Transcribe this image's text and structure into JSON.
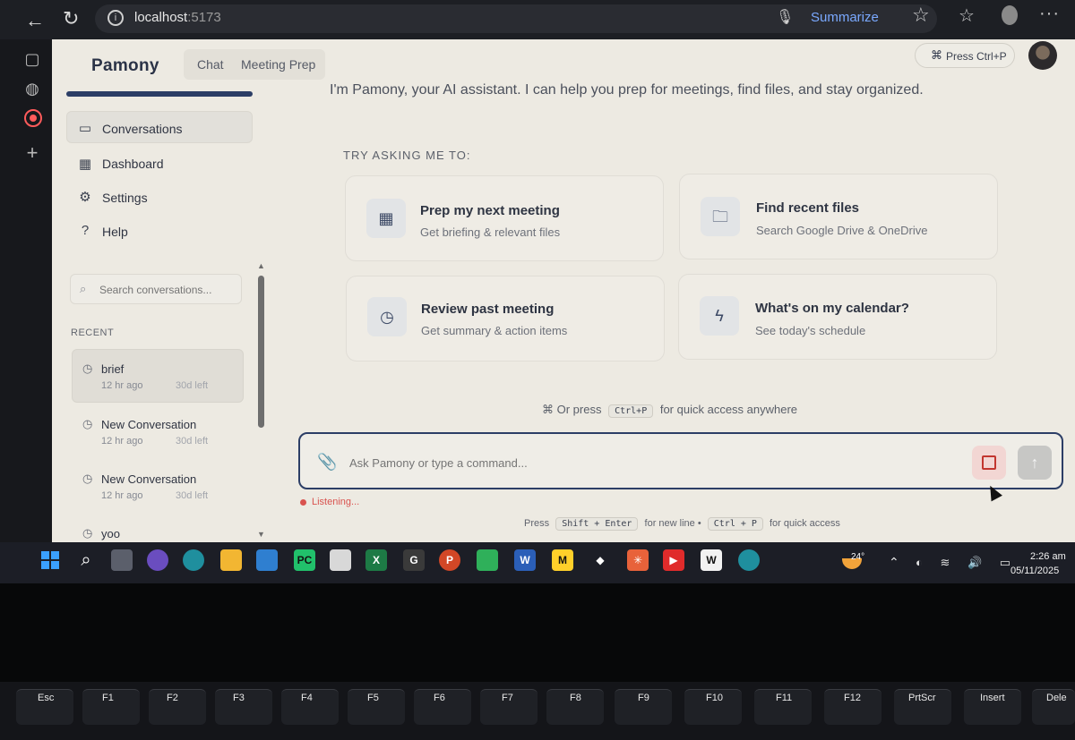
{
  "browser": {
    "url_host": "localhost",
    "url_port": ":5173",
    "summarize_label": "Summarize"
  },
  "app": {
    "logo": "Pamony",
    "tabs": [
      {
        "label": "Chat"
      },
      {
        "label": "Meeting Prep"
      }
    ],
    "press_ctrl_label": "Press Ctrl+P"
  },
  "sidebar": {
    "items": [
      {
        "label": "Conversations",
        "icon": "chat-bubble-icon"
      },
      {
        "label": "Dashboard",
        "icon": "grid-icon"
      },
      {
        "label": "Settings",
        "icon": "gear-icon"
      },
      {
        "label": "Help",
        "icon": "help-circle-icon"
      }
    ],
    "search_placeholder": "Search conversations...",
    "recent_label": "RECENT",
    "conversations": [
      {
        "title": "brief",
        "age": "12 hr ago",
        "expires": "30d left"
      },
      {
        "title": "New Conversation",
        "age": "12 hr ago",
        "expires": "30d left"
      },
      {
        "title": "New Conversation",
        "age": "12 hr ago",
        "expires": "30d left"
      },
      {
        "title": "yoo"
      }
    ]
  },
  "main": {
    "welcome": "I'm Pamony, your AI assistant. I can help you prep for meetings, find files, and stay organized.",
    "try_label": "TRY ASKING ME TO:",
    "cards": [
      {
        "title": "Prep my next meeting",
        "subtitle": "Get briefing & relevant files",
        "icon": "calendar-icon"
      },
      {
        "title": "Find recent files",
        "subtitle": "Search Google Drive & OneDrive",
        "icon": "folder-search-icon"
      },
      {
        "title": "Review past meeting",
        "subtitle": "Get summary & action items",
        "icon": "clock-icon"
      },
      {
        "title": "What's on my calendar?",
        "subtitle": "See today's schedule",
        "icon": "lightning-icon"
      }
    ],
    "quick_hint_pre": "Or press",
    "quick_hint_key": "Ctrl+P",
    "quick_hint_post": "for quick access anywhere",
    "composer_placeholder": "Ask Pamony or type a command...",
    "listening": "Listening...",
    "bottom_hint": {
      "press": "Press",
      "key1": "Shift + Enter",
      "mid": "for new line •",
      "key2": "Ctrl + P",
      "end": "for quick access"
    }
  },
  "taskbar": {
    "temperature": "24°",
    "time": "2:26 am",
    "date": "05/11/2025"
  },
  "keyboard": {
    "keys": [
      "Esc",
      "F1",
      "F2",
      "F3",
      "F4",
      "F5",
      "F6",
      "F7",
      "F8",
      "F9",
      "F10",
      "F11",
      "F12",
      "PrtScr",
      "Insert",
      "Dele"
    ]
  }
}
